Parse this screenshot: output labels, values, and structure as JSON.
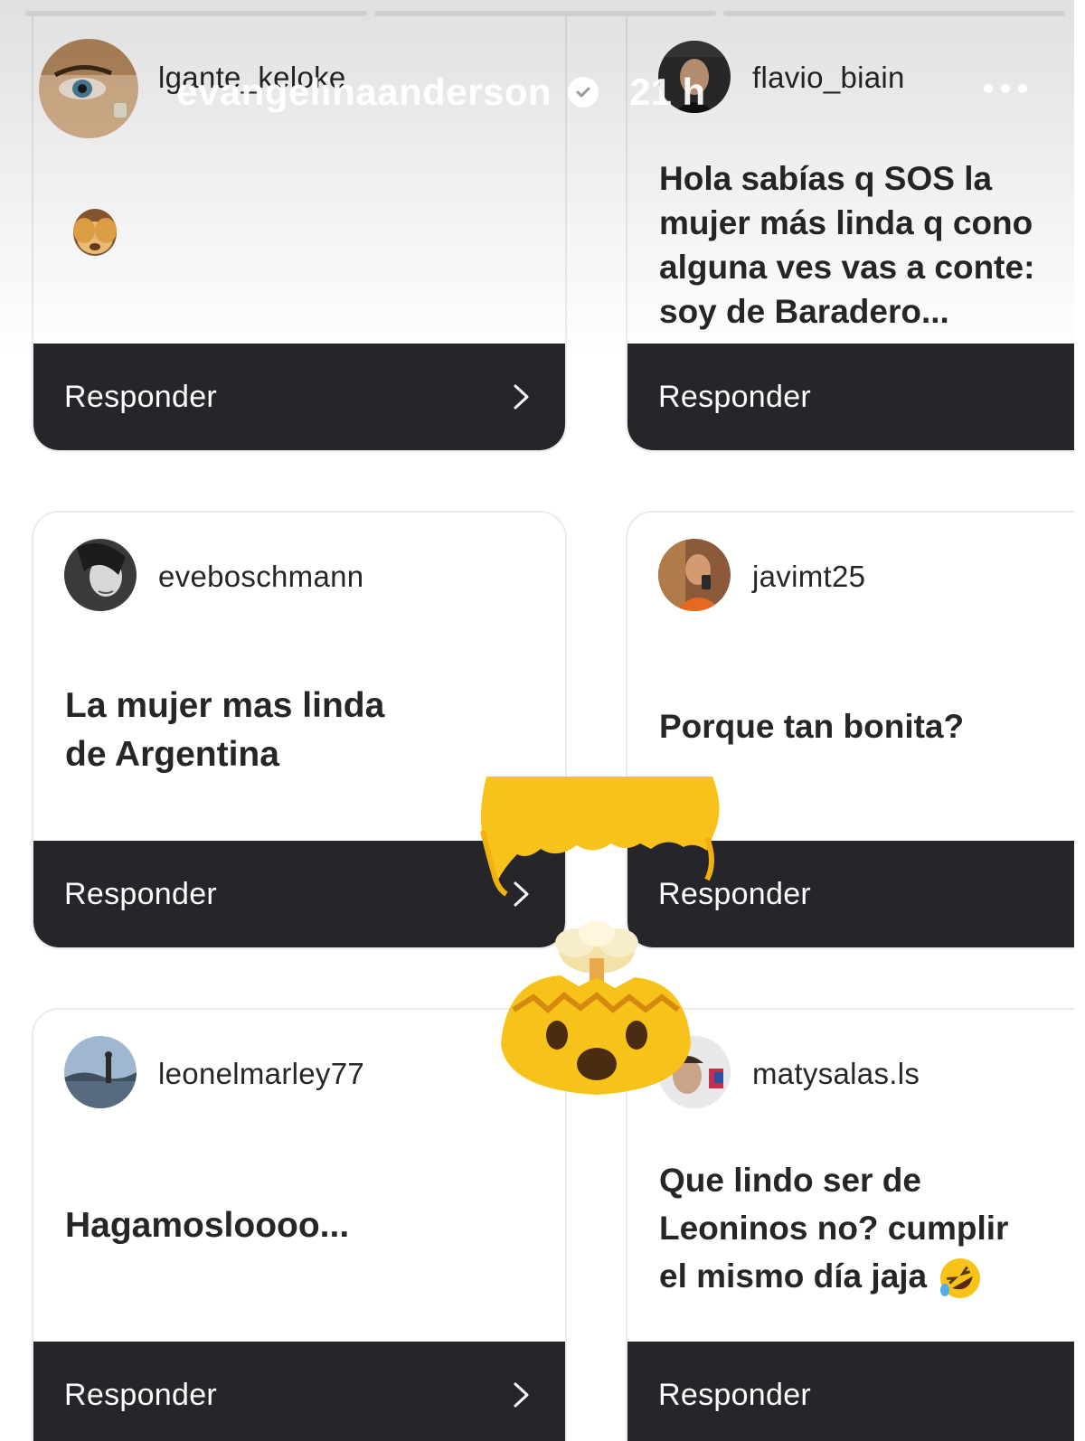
{
  "story": {
    "username": "evangelinaanderson",
    "time": "21 h"
  },
  "colors": {
    "button_bg": "#26262a",
    "text": "#262626",
    "emoji_yellow": "#f7c21a"
  },
  "cards": [
    {
      "username": "lgante_keloke",
      "message_lines": [],
      "reaction": "see-no-evil-monkey-emoji",
      "button": "Responder"
    },
    {
      "username": "flavio_biain",
      "message_lines": [
        "Hola sabías q SOS la",
        "mujer más linda q cono",
        "alguna ves vas a conte:",
        "soy de Baradero..."
      ],
      "button": "Responder"
    },
    {
      "username": "eveboschmann",
      "message_lines": [
        "La mujer mas linda",
        "de Argentina"
      ],
      "button": "Responder"
    },
    {
      "username": "javimt25",
      "message_lines": [
        "Porque tan bonita?"
      ],
      "button": "Responder"
    },
    {
      "username": "leonelmarley77",
      "message_lines": [
        "Hagamosloooo..."
      ],
      "button": "Responder"
    },
    {
      "username": "matysalas.ls",
      "message_lines": [
        "Que lindo ser de",
        "Leoninos no? cumplir",
        "el mismo día jaja"
      ],
      "reaction": "rolling-on-floor-laughing-emoji",
      "button": "Responder"
    }
  ],
  "sticker": "exploding-head-emoji"
}
